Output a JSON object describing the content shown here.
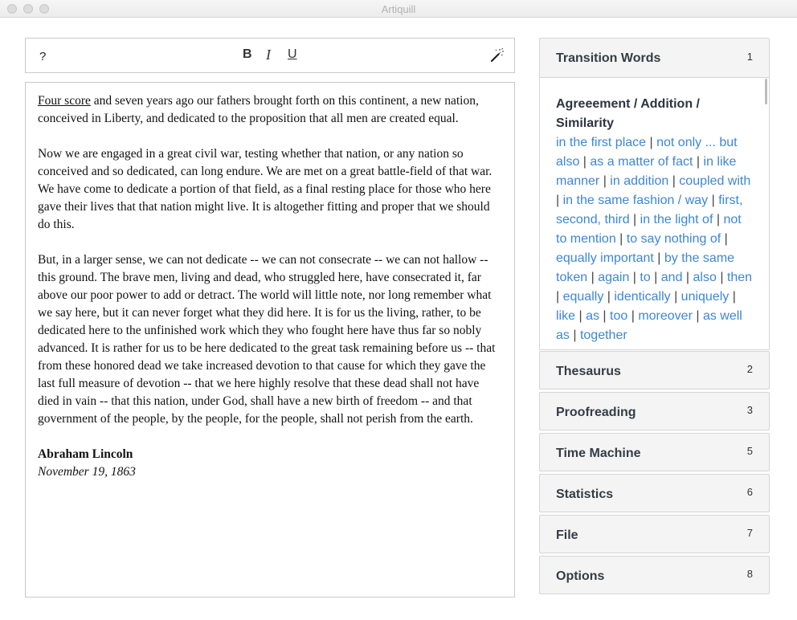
{
  "window": {
    "title": "Artiquill"
  },
  "toolbar": {
    "help_label": "?",
    "bold_label": "B",
    "italic_label": "I",
    "underline_label": "U",
    "magic_icon": "magic-wand-icon"
  },
  "document": {
    "p1_underlined": "Four score",
    "p1_rest": " and seven years ago our fathers brought forth on this continent, a new nation, conceived in Liberty, and dedicated to the proposition that all men are created equal.",
    "p2": "Now we are engaged in a great civil war, testing whether that nation, or any nation so conceived and so dedicated, can long endure. We are met on a great battle-field of that war. We have come to dedicate a portion of that field, as a final resting place for those who here gave their lives that that nation might live. It is altogether fitting and proper that we should do this.",
    "p3": "But, in a larger sense, we can not dedicate -- we can not consecrate -- we can not hallow -- this ground. The brave men, living and dead, who struggled here, have consecrated it, far above our poor power to add or detract. The world will little note, nor long remember what we say here, but it can never forget what they did here. It is for us the living, rather, to be dedicated here to the unfinished work which they who fought here have thus far so nobly advanced. It is rather for us to be here dedicated to the great task remaining before us -- that from these honored dead we take increased devotion to that cause for which they gave the last full measure of devotion -- that we here highly resolve that these dead shall not have died in vain -- that this nation, under God, shall have a new birth of freedom -- and that government of the people, by the people, for the people, shall not perish from the earth.",
    "signature_name": "Abraham Lincoln",
    "signature_date": "November 19, 1863"
  },
  "sidebar": {
    "transition": {
      "title": "Transition Words",
      "num": "1",
      "category": "Agreeement / Addition / Similarity",
      "phrases": [
        "in the first place",
        "not only ... but also",
        "as a matter of fact",
        "in like manner",
        "in addition",
        "coupled with",
        "in the same fashion / way",
        "first, second, third",
        "in the light of",
        "not to mention",
        "to say nothing of",
        "equally important",
        "by the same token",
        "again",
        "to",
        "and",
        "also",
        "then",
        "equally",
        "identically",
        "uniquely",
        "like",
        "as",
        "too",
        "moreover",
        "as well as",
        "together"
      ]
    },
    "panels": [
      {
        "title": "Thesaurus",
        "num": "2"
      },
      {
        "title": "Proofreading",
        "num": "3"
      },
      {
        "title": "Time Machine",
        "num": "5"
      },
      {
        "title": "Statistics",
        "num": "6"
      },
      {
        "title": "File",
        "num": "7"
      },
      {
        "title": "Options",
        "num": "8"
      }
    ]
  }
}
